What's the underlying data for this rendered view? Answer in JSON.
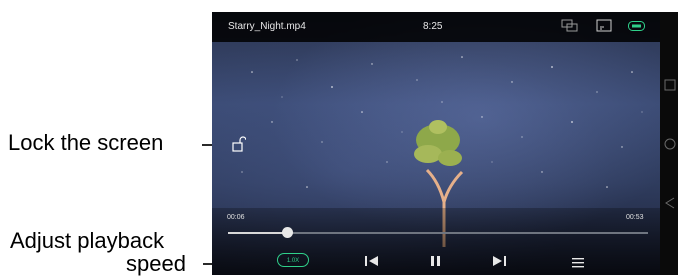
{
  "callouts": {
    "lock": "Lock the screen",
    "speed_line1": "Adjust playback",
    "speed_line2": "speed"
  },
  "player": {
    "file_name": "Starry_Night.mp4",
    "clock": "8:25",
    "elapsed": "00:06",
    "duration": "00:53",
    "progress_fraction": 0.14,
    "speed": "1.0X"
  },
  "colors": {
    "accent": "#2fd08a",
    "icons": "#e8e8e8"
  },
  "icons": {
    "screen": "screen-mirror-icon",
    "cast": "cast-icon",
    "battery": "battery-icon",
    "lock": "unlock-icon",
    "prev": "skip-previous-icon",
    "pause": "pause-icon",
    "next": "skip-next-icon",
    "playlist": "playlist-icon",
    "nav_recent": "recent-apps-icon",
    "nav_home": "home-icon",
    "nav_back": "back-icon"
  }
}
